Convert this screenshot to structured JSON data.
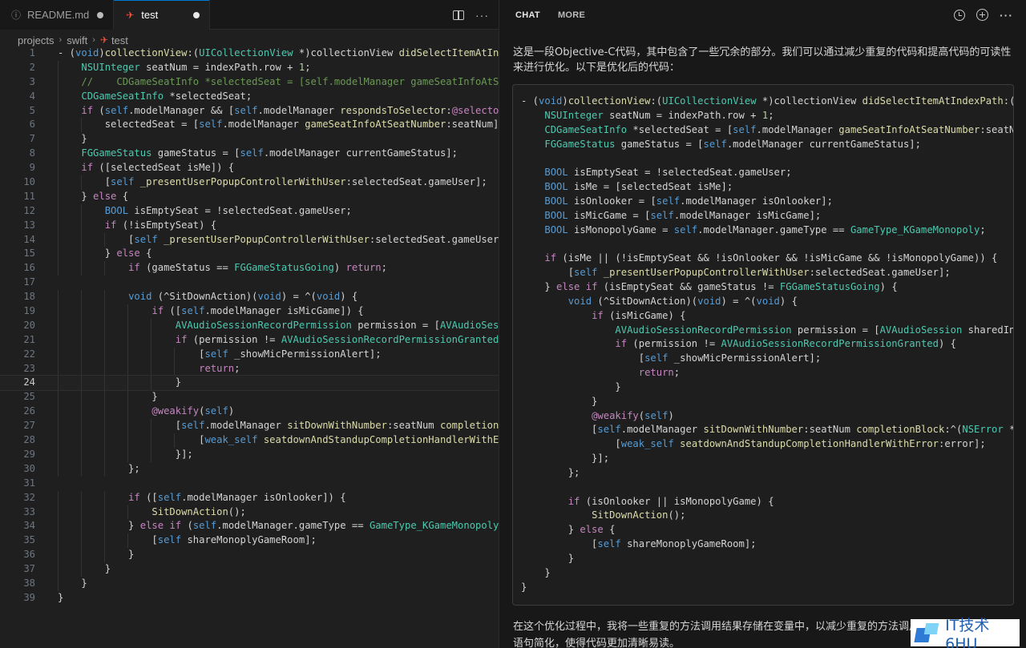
{
  "editor": {
    "tabs": [
      {
        "label": "README.md",
        "icon": "info-icon",
        "dirty": true,
        "active": false
      },
      {
        "label": "test",
        "icon": "swift-icon",
        "dirty": true,
        "active": true
      }
    ],
    "breadcrumb": [
      "projects",
      "swift",
      "test"
    ],
    "current_line": 24,
    "lines": [
      "- (void)collectionView:(UICollectionView *)collectionView didSelectItemAtIndexPath:(NSIndexPath *)indexPath {",
      "    NSUInteger seatNum = indexPath.row + 1;",
      "    //    CDGameSeatInfo *selectedSeat = [self.modelManager gameSeatInfoAtSeatNumber:seatNum];",
      "    CDGameSeatInfo *selectedSeat;",
      "    if (self.modelManager && [self.modelManager respondsToSelector:@selector(gameSeatInfoAtSeatNumber:)]) {",
      "        selectedSeat = [self.modelManager gameSeatInfoAtSeatNumber:seatNum];",
      "    }",
      "    FGGameStatus gameStatus = [self.modelManager currentGameStatus];",
      "    if ([selectedSeat isMe]) {",
      "        [self _presentUserPopupControllerWithUser:selectedSeat.gameUser];",
      "    } else {",
      "        BOOL isEmptySeat = !selectedSeat.gameUser;",
      "        if (!isEmptySeat) {",
      "            [self _presentUserPopupControllerWithUser:selectedSeat.gameUser];",
      "        } else {",
      "            if (gameStatus == FGGameStatusGoing) return;",
      "",
      "            void (^SitDownAction)(void) = ^(void) {",
      "                if ([self.modelManager isMicGame]) {",
      "                    AVAudioSessionRecordPermission permission = [AVAudioSession sharedInstance].recordPermission;",
      "                    if (permission != AVAudioSessionRecordPermissionGranted) {",
      "                        [self _showMicPermissionAlert];",
      "                        return;",
      "                    }",
      "                }",
      "                @weakify(self)",
      "                    [self.modelManager sitDownWithNumber:seatNum completionBlock:^(NSError *error) {",
      "                        [weak_self seatdownAndStandupCompletionHandlerWithError:error];",
      "                    }];",
      "            };",
      "",
      "            if ([self.modelManager isOnlooker]) {",
      "                SitDownAction();",
      "            } else if (self.modelManager.gameType == GameType_KGameMonopoly) {",
      "                [self shareMonoplyGameRoom];",
      "            }",
      "        }",
      "    }",
      "}"
    ]
  },
  "chat": {
    "tabs": [
      "CHAT",
      "MORE"
    ],
    "intro": "这是一段Objective-C代码，其中包含了一些冗余的部分。我们可以通过减少重复的代码和提高代码的可读性来进行优化。以下是优化后的代码：",
    "code_lines": [
      "- (void)collectionView:(UICollectionView *)collectionView didSelectItemAtIndexPath:(NSIndexPath *)indexPath {",
      "    NSUInteger seatNum = indexPath.row + 1;",
      "    CDGameSeatInfo *selectedSeat = [self.modelManager gameSeatInfoAtSeatNumber:seatNum];",
      "    FGGameStatus gameStatus = [self.modelManager currentGameStatus];",
      "",
      "    BOOL isEmptySeat = !selectedSeat.gameUser;",
      "    BOOL isMe = [selectedSeat isMe];",
      "    BOOL isOnlooker = [self.modelManager isOnlooker];",
      "    BOOL isMicGame = [self.modelManager isMicGame];",
      "    BOOL isMonopolyGame = self.modelManager.gameType == GameType_KGameMonopoly;",
      "",
      "    if (isMe || (!isEmptySeat && !isOnlooker && !isMicGame && !isMonopolyGame)) {",
      "        [self _presentUserPopupControllerWithUser:selectedSeat.gameUser];",
      "    } else if (isEmptySeat && gameStatus != FGGameStatusGoing) {",
      "        void (^SitDownAction)(void) = ^(void) {",
      "            if (isMicGame) {",
      "                AVAudioSessionRecordPermission permission = [AVAudioSession sharedInstance].recordPermission;",
      "                if (permission != AVAudioSessionRecordPermissionGranted) {",
      "                    [self _showMicPermissionAlert];",
      "                    return;",
      "                }",
      "            }",
      "            @weakify(self)",
      "            [self.modelManager sitDownWithNumber:seatNum completionBlock:^(NSError *error) {",
      "                [weak_self seatdownAndStandupCompletionHandlerWithError:error];",
      "            }];",
      "        };",
      "",
      "        if (isOnlooker || isMonopolyGame) {",
      "            SitDownAction();",
      "        } else {",
      "            [self shareMonoplyGameRoom];",
      "        }",
      "    }",
      "}"
    ],
    "outro": "在这个优化过程中，我将一些重复的方法调用结果存储在变量中，以减少重复的方法调用。同时，我将条件语句简化，使得代码更加清晰易读。"
  },
  "watermark": "IT技术6HU",
  "colors": {
    "keyword": "#569cd6",
    "control": "#c586c0",
    "string": "#ce9178",
    "type": "#4ec9b0",
    "method": "#dcdcaa",
    "number": "#b5cea8",
    "comment": "#6a9955",
    "variable": "#9cdcfe"
  }
}
